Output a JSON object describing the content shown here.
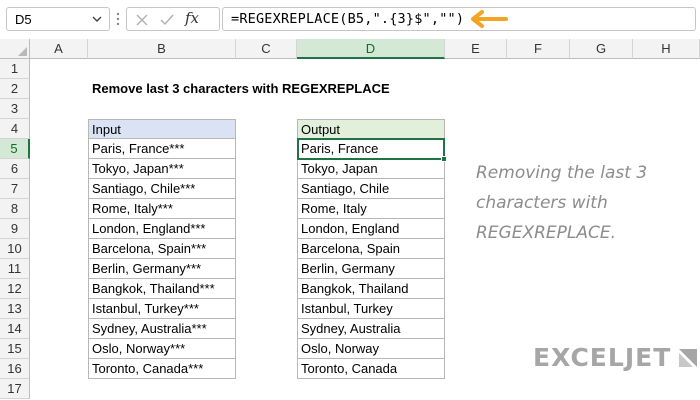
{
  "formula_bar": {
    "name_box": "D5",
    "formula": "=REGEXREPLACE(B5,\".{3}$\",\"\")"
  },
  "columns": [
    "A",
    "B",
    "C",
    "D",
    "E",
    "F",
    "G",
    "H"
  ],
  "rows": [
    "1",
    "2",
    "3",
    "4",
    "5",
    "6",
    "7",
    "8",
    "9",
    "10",
    "11",
    "12",
    "13",
    "14",
    "15",
    "16",
    "17"
  ],
  "active_cell": {
    "column": "D",
    "row": "5"
  },
  "sheet": {
    "title": "Remove last 3 characters with REGEXREPLACE",
    "input_header": "Input",
    "output_header": "Output",
    "inputs": [
      "Paris, France***",
      "Tokyo, Japan***",
      "Santiago, Chile***",
      "Rome, Italy***",
      "London, England***",
      "Barcelona, Spain***",
      "Berlin, Germany***",
      "Bangkok, Thailand***",
      "Istanbul, Turkey***",
      "Sydney, Australia***",
      "Oslo, Norway***",
      "Toronto, Canada***"
    ],
    "outputs": [
      "Paris, France",
      "Tokyo, Japan",
      "Santiago, Chile",
      "Rome, Italy",
      "London, England",
      "Barcelona, Spain",
      "Berlin, Germany",
      "Bangkok, Thailand",
      "Istanbul, Turkey",
      "Sydney, Australia",
      "Oslo, Norway",
      "Toronto, Canada"
    ]
  },
  "note": "Removing the last 3 characters with REGEXREPLACE.",
  "logo": {
    "text": "EXCELJET",
    "icon": "exceljet-logo-icon",
    "color": "#a6a6a6"
  },
  "colors": {
    "accent": "#217346",
    "arrow": "#f3a423",
    "input_header": "#dae3f3",
    "output_header": "#e2efda"
  }
}
